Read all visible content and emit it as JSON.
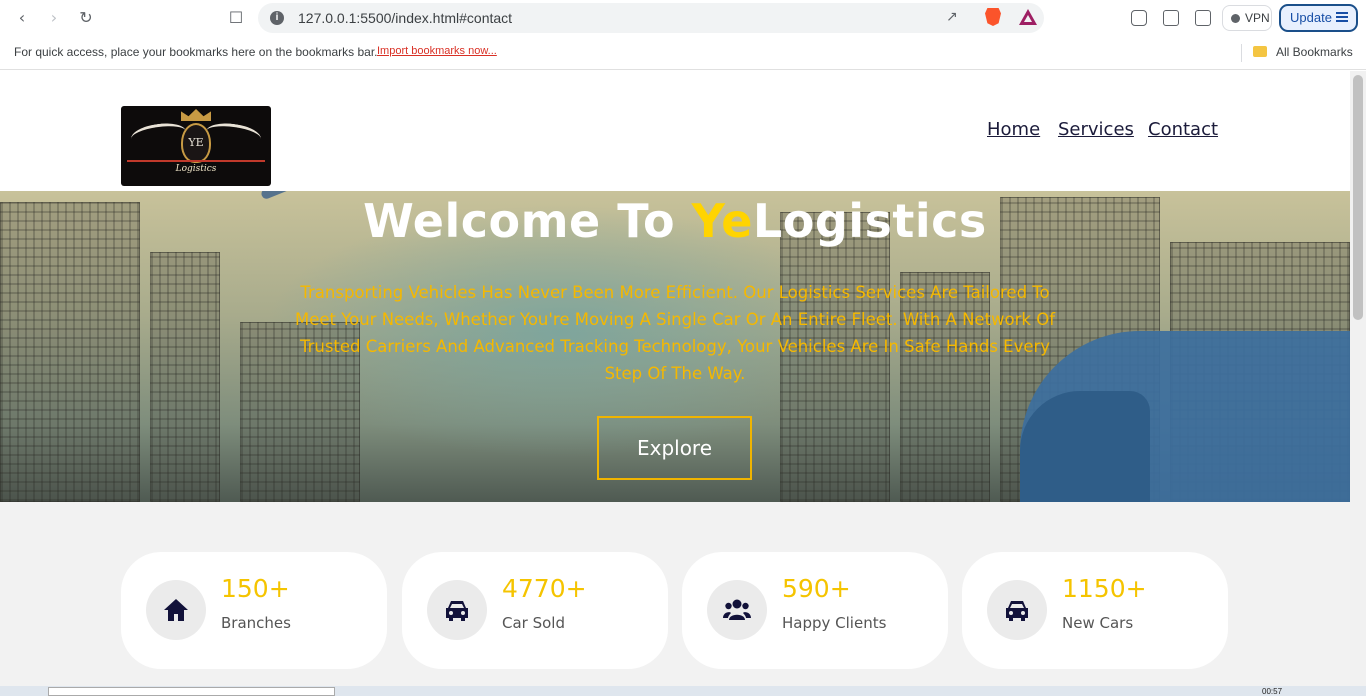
{
  "browser": {
    "url": "127.0.0.1:5500/index.html#contact",
    "vpn_label": "VPN",
    "update_label": "Update",
    "bookmarks_prompt": "For quick access, place your bookmarks here on the bookmarks bar.",
    "import_link": "Import bookmarks now...",
    "all_bookmarks": "All Bookmarks"
  },
  "header": {
    "logo_initials": "YE",
    "logo_text": "Logistics",
    "nav": [
      {
        "label": "Home"
      },
      {
        "label": "Services"
      },
      {
        "label": "Contact"
      }
    ]
  },
  "hero": {
    "title_prefix": "Welcome To ",
    "title_accent": "Ye",
    "title_suffix": "Logistics",
    "description": "Transporting Vehicles Has Never Been More Efficient. Our Logistics Services Are Tailored To Meet Your Needs, Whether You're Moving A Single Car Or An Entire Fleet. With A Network Of Trusted Carriers And Advanced Tracking Technology, Your Vehicles Are In Safe Hands Every Step Of The Way.",
    "button_label": "Explore"
  },
  "stats": [
    {
      "value": "150+",
      "label": "Branches",
      "icon": "home-icon"
    },
    {
      "value": "4770+",
      "label": "Car Sold",
      "icon": "car-icon"
    },
    {
      "value": "590+",
      "label": "Happy Clients",
      "icon": "users-icon"
    },
    {
      "value": "1150+",
      "label": "New Cars",
      "icon": "car-icon"
    }
  ],
  "taskbar": {
    "clock": "00:57"
  },
  "colors": {
    "accent_yellow": "#ffd400",
    "nav_text": "#1b1b3a",
    "icon_navy": "#12123a"
  }
}
